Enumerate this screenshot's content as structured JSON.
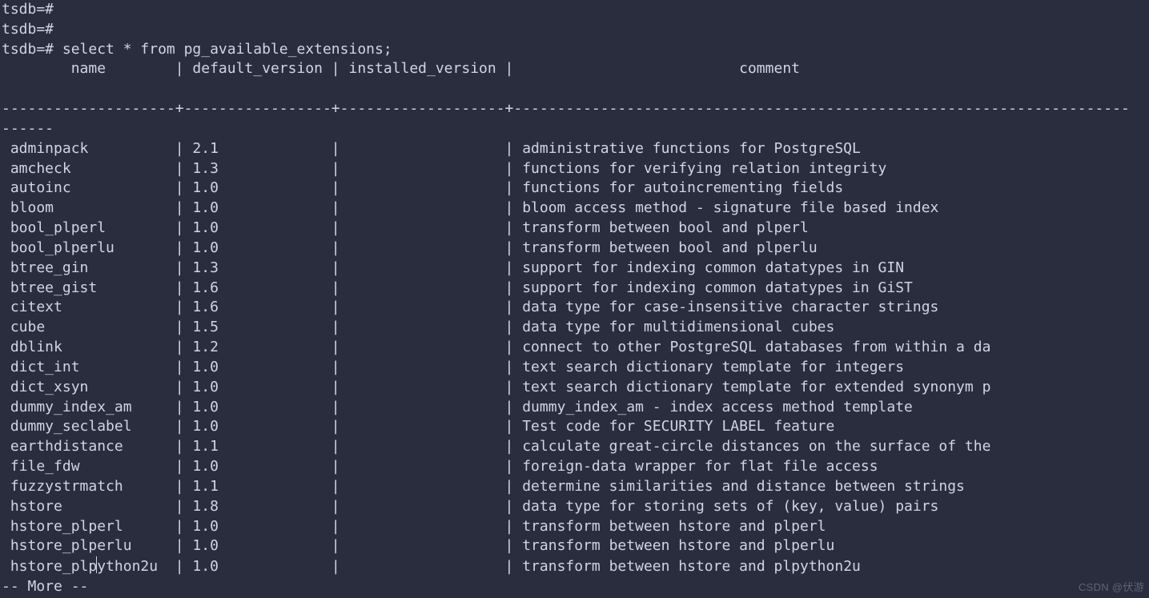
{
  "prompt_lines": [
    "tsdb=# ",
    "tsdb=# ",
    "tsdb=# select * from pg_available_extensions;"
  ],
  "headers": {
    "name": "name",
    "default_version": "default_version",
    "installed_version": "installed_version",
    "comment": "comment"
  },
  "rows": [
    {
      "name": "adminpack",
      "default_version": "2.1",
      "installed_version": "",
      "comment": "administrative functions for PostgreSQL"
    },
    {
      "name": "amcheck",
      "default_version": "1.3",
      "installed_version": "",
      "comment": "functions for verifying relation integrity"
    },
    {
      "name": "autoinc",
      "default_version": "1.0",
      "installed_version": "",
      "comment": "functions for autoincrementing fields"
    },
    {
      "name": "bloom",
      "default_version": "1.0",
      "installed_version": "",
      "comment": "bloom access method - signature file based index"
    },
    {
      "name": "bool_plperl",
      "default_version": "1.0",
      "installed_version": "",
      "comment": "transform between bool and plperl"
    },
    {
      "name": "bool_plperlu",
      "default_version": "1.0",
      "installed_version": "",
      "comment": "transform between bool and plperlu"
    },
    {
      "name": "btree_gin",
      "default_version": "1.3",
      "installed_version": "",
      "comment": "support for indexing common datatypes in GIN"
    },
    {
      "name": "btree_gist",
      "default_version": "1.6",
      "installed_version": "",
      "comment": "support for indexing common datatypes in GiST"
    },
    {
      "name": "citext",
      "default_version": "1.6",
      "installed_version": "",
      "comment": "data type for case-insensitive character strings"
    },
    {
      "name": "cube",
      "default_version": "1.5",
      "installed_version": "",
      "comment": "data type for multidimensional cubes"
    },
    {
      "name": "dblink",
      "default_version": "1.2",
      "installed_version": "",
      "comment": "connect to other PostgreSQL databases from within a da"
    },
    {
      "name": "dict_int",
      "default_version": "1.0",
      "installed_version": "",
      "comment": "text search dictionary template for integers"
    },
    {
      "name": "dict_xsyn",
      "default_version": "1.0",
      "installed_version": "",
      "comment": "text search dictionary template for extended synonym p"
    },
    {
      "name": "dummy_index_am",
      "default_version": "1.0",
      "installed_version": "",
      "comment": "dummy_index_am - index access method template"
    },
    {
      "name": "dummy_seclabel",
      "default_version": "1.0",
      "installed_version": "",
      "comment": "Test code for SECURITY LABEL feature"
    },
    {
      "name": "earthdistance",
      "default_version": "1.1",
      "installed_version": "",
      "comment": "calculate great-circle distances on the surface of the"
    },
    {
      "name": "file_fdw",
      "default_version": "1.0",
      "installed_version": "",
      "comment": "foreign-data wrapper for flat file access"
    },
    {
      "name": "fuzzystrmatch",
      "default_version": "1.1",
      "installed_version": "",
      "comment": "determine similarities and distance between strings"
    },
    {
      "name": "hstore",
      "default_version": "1.8",
      "installed_version": "",
      "comment": "data type for storing sets of (key, value) pairs"
    },
    {
      "name": "hstore_plperl",
      "default_version": "1.0",
      "installed_version": "",
      "comment": "transform between hstore and plperl"
    },
    {
      "name": "hstore_plperlu",
      "default_version": "1.0",
      "installed_version": "",
      "comment": "transform between hstore and plperlu"
    },
    {
      "name": "hstore_plpython2u",
      "default_version": "1.0",
      "installed_version": "",
      "comment": "transform between hstore and plpython2u"
    }
  ],
  "pager_prompt": "-- More --",
  "watermark": "CSDN @伏游",
  "col_widths": {
    "name": 20,
    "default_version": 17,
    "installed_version": 19
  },
  "cursor_row": 21,
  "cursor_col": 11
}
